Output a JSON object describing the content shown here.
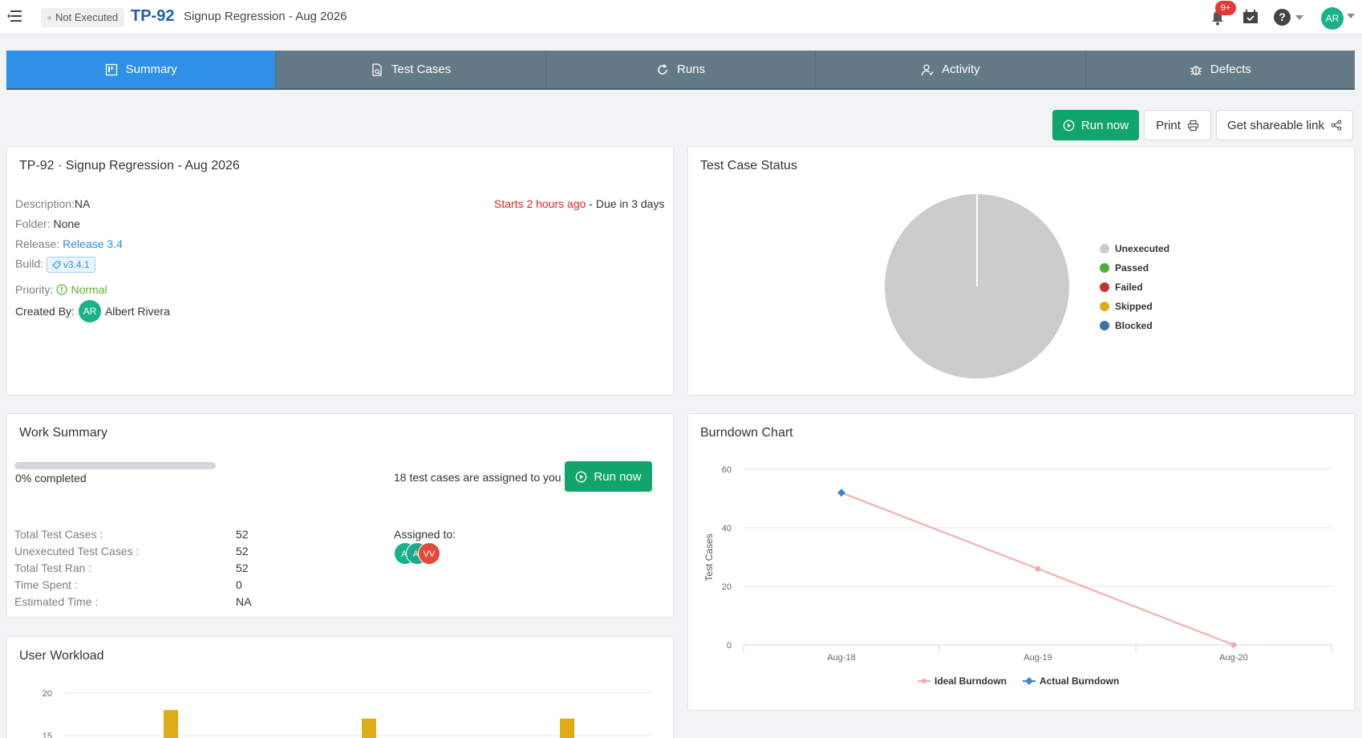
{
  "header": {
    "status": "Not Executed",
    "plan_id": "TP-92",
    "plan_title": "Signup Regression - Aug 2026",
    "notification_count": "9+",
    "help_label": "?",
    "user_initials": "AR"
  },
  "tabs": [
    {
      "label": "Summary",
      "icon": "summary-icon"
    },
    {
      "label": "Test Cases",
      "icon": "test-cases-icon"
    },
    {
      "label": "Runs",
      "icon": "refresh-icon"
    },
    {
      "label": "Activity",
      "icon": "activity-icon"
    },
    {
      "label": "Defects",
      "icon": "bug-icon"
    }
  ],
  "actions": {
    "run_now": "Run now",
    "print": "Print",
    "share": "Get shareable link"
  },
  "details": {
    "title": "TP-92 · Signup Regression - Aug 2026",
    "description_label": "Description:",
    "description_value": "NA",
    "folder_label": "Folder:",
    "folder_value": "None",
    "release_label": "Release:",
    "release_value": "Release 3.4",
    "build_label": "Build:",
    "build_value": "v3.4.1",
    "priority_label": "Priority:",
    "priority_value": "Normal",
    "created_label": "Created By:",
    "created_initials": "AR",
    "created_name": "Albert Rivera",
    "starts": "Starts 2 hours ago",
    "due": " - Due in 3 days"
  },
  "status_chart": {
    "title": "Test Case Status",
    "legend": [
      {
        "label": "Unexecuted",
        "color": "#cccccc"
      },
      {
        "label": "Passed",
        "color": "#4caf3a"
      },
      {
        "label": "Failed",
        "color": "#c43333"
      },
      {
        "label": "Skipped",
        "color": "#e0ac16"
      },
      {
        "label": "Blocked",
        "color": "#3a70b0"
      }
    ]
  },
  "work_summary": {
    "title": "Work Summary",
    "progress_percent": 0,
    "completed_text": "0% completed",
    "assigned_text": "18 test cases are assigned to you",
    "run_now": "Run now",
    "stats": [
      {
        "label": "Total Test Cases :",
        "value": "52"
      },
      {
        "label": "Unexecuted Test Cases :",
        "value": "52"
      },
      {
        "label": "Total Test Ran :",
        "value": "52"
      },
      {
        "label": "Time Spent :",
        "value": "0"
      },
      {
        "label": "Estimated Time :",
        "value": "NA"
      }
    ],
    "assigned_label": "Assigned to:",
    "assignees": [
      {
        "initials": "Al",
        "color": "#18b18a"
      },
      {
        "initials": "A.",
        "color": "#1ea889"
      },
      {
        "initials": "VV",
        "color": "#e24a3b"
      }
    ]
  },
  "chart_data": [
    {
      "type": "pie",
      "title": "Test Case Status",
      "categories": [
        "Unexecuted",
        "Passed",
        "Failed",
        "Skipped",
        "Blocked"
      ],
      "values": [
        52,
        0,
        0,
        0,
        0
      ],
      "legend": "right"
    },
    {
      "type": "line",
      "title": "Burndown Chart",
      "ylabel": "Test Cases",
      "x": [
        "Aug-18",
        "Aug-19",
        "Aug-20"
      ],
      "ylim": [
        0,
        60
      ],
      "yticks": [
        0,
        20,
        40,
        60
      ],
      "series": [
        {
          "name": "Ideal Burndown",
          "values": [
            52,
            26,
            0
          ],
          "color": "#f6a8a8"
        },
        {
          "name": "Actual Burndown",
          "values": [
            52,
            null,
            null
          ],
          "color": "#3a86d0"
        }
      ],
      "legend": "bottom"
    },
    {
      "type": "bar",
      "title": "User Workload",
      "yticks": [
        15,
        20
      ],
      "values": [
        18,
        17,
        17
      ],
      "color": "#e0ac16"
    }
  ],
  "burndown": {
    "title": "Burndown Chart",
    "ylabel": "Test Cases",
    "yticks": [
      "0",
      "20",
      "40",
      "60"
    ],
    "xticks": [
      "Aug-18",
      "Aug-19",
      "Aug-20"
    ],
    "legend_ideal": "Ideal Burndown",
    "legend_actual": "Actual Burndown"
  },
  "workload": {
    "title": "User Workload",
    "yticks": [
      "15",
      "20"
    ]
  }
}
